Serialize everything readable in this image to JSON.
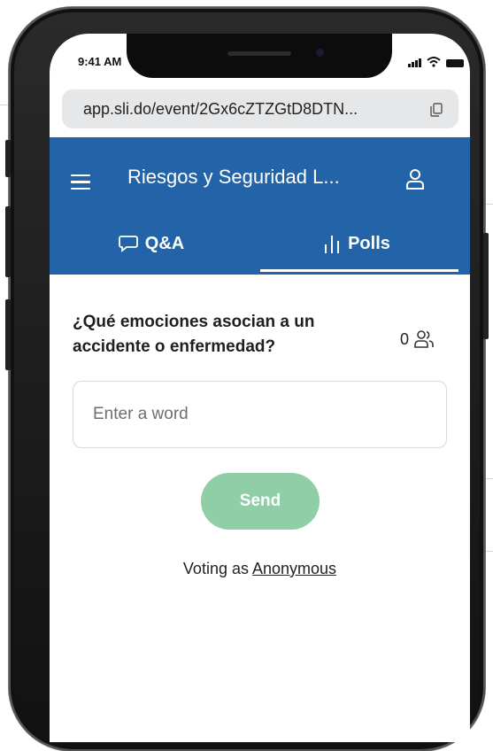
{
  "status_bar": {
    "time": "9:41 AM"
  },
  "browser": {
    "url": "app.sli.do/event/2Gx6cZTZGtD8DTN..."
  },
  "header": {
    "title": "Riesgos y Seguridad L...",
    "menu_icon": "hamburger-icon",
    "user_icon": "user-icon"
  },
  "tabs": [
    {
      "label": "Q&A",
      "icon": "speech-bubble-icon",
      "active": false
    },
    {
      "label": "Polls",
      "icon": "bar-chart-icon",
      "active": true
    }
  ],
  "poll": {
    "question": "¿Qué emociones asocian a un accidente o enfermedad?",
    "participant_count": "0",
    "input_placeholder": "Enter a word",
    "input_value": "",
    "send_label": "Send"
  },
  "footer": {
    "voting_prefix": "Voting as",
    "voting_name": "Anonymous"
  },
  "colors": {
    "header_bg": "#2364a8",
    "send_button": "#8fcea7",
    "url_bar": "#e6e7e8"
  }
}
